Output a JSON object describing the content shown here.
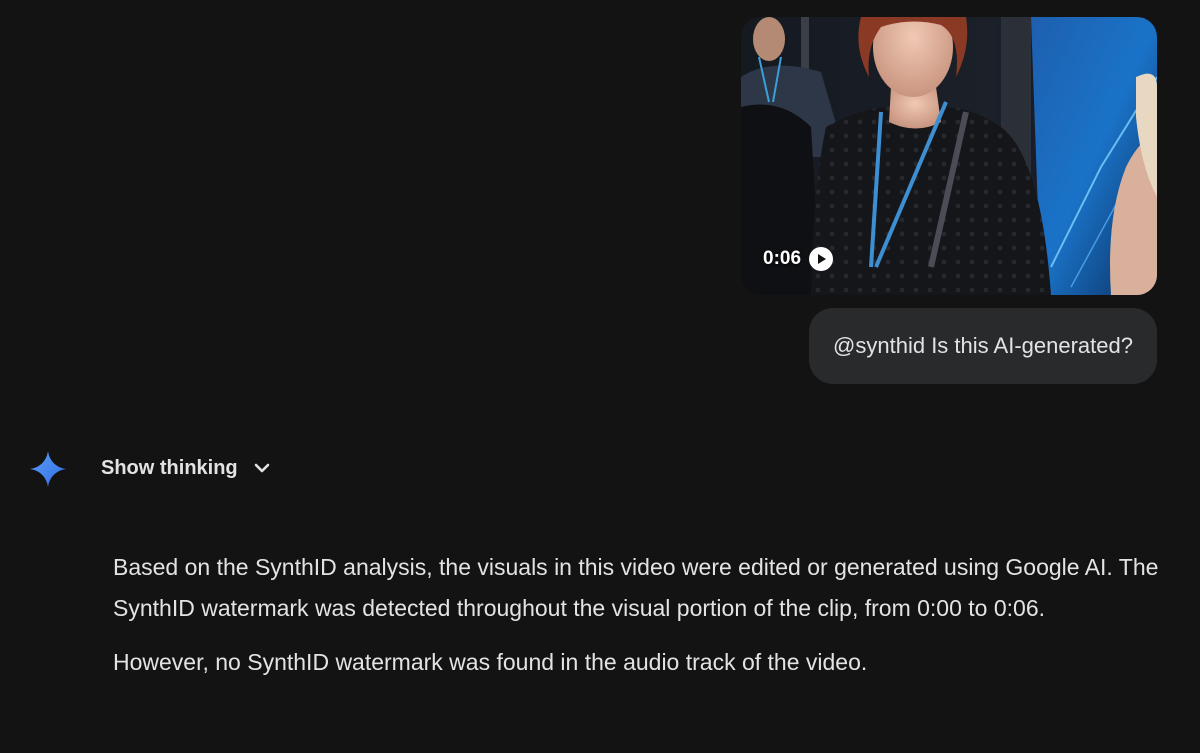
{
  "video": {
    "duration": "0:06",
    "play_icon": "play-icon"
  },
  "user_message": {
    "text": "@synthid Is this AI-generated?"
  },
  "response": {
    "avatar_icon": "gemini-sparkle-icon",
    "show_thinking_label": "Show thinking",
    "toggle_icon": "chevron-down-icon",
    "paragraphs": [
      "Based on the SynthID analysis, the visuals in this video were edited or generated using Google AI. The SynthID watermark was detected throughout the visual portion of the clip, from 0:00 to 0:06.",
      "However, no SynthID watermark was found in the audio track of the video."
    ]
  },
  "colors": {
    "background": "#131314",
    "bubble": "#282a2c",
    "text": "#e3e3e3",
    "accent": "#4a8cf7"
  }
}
